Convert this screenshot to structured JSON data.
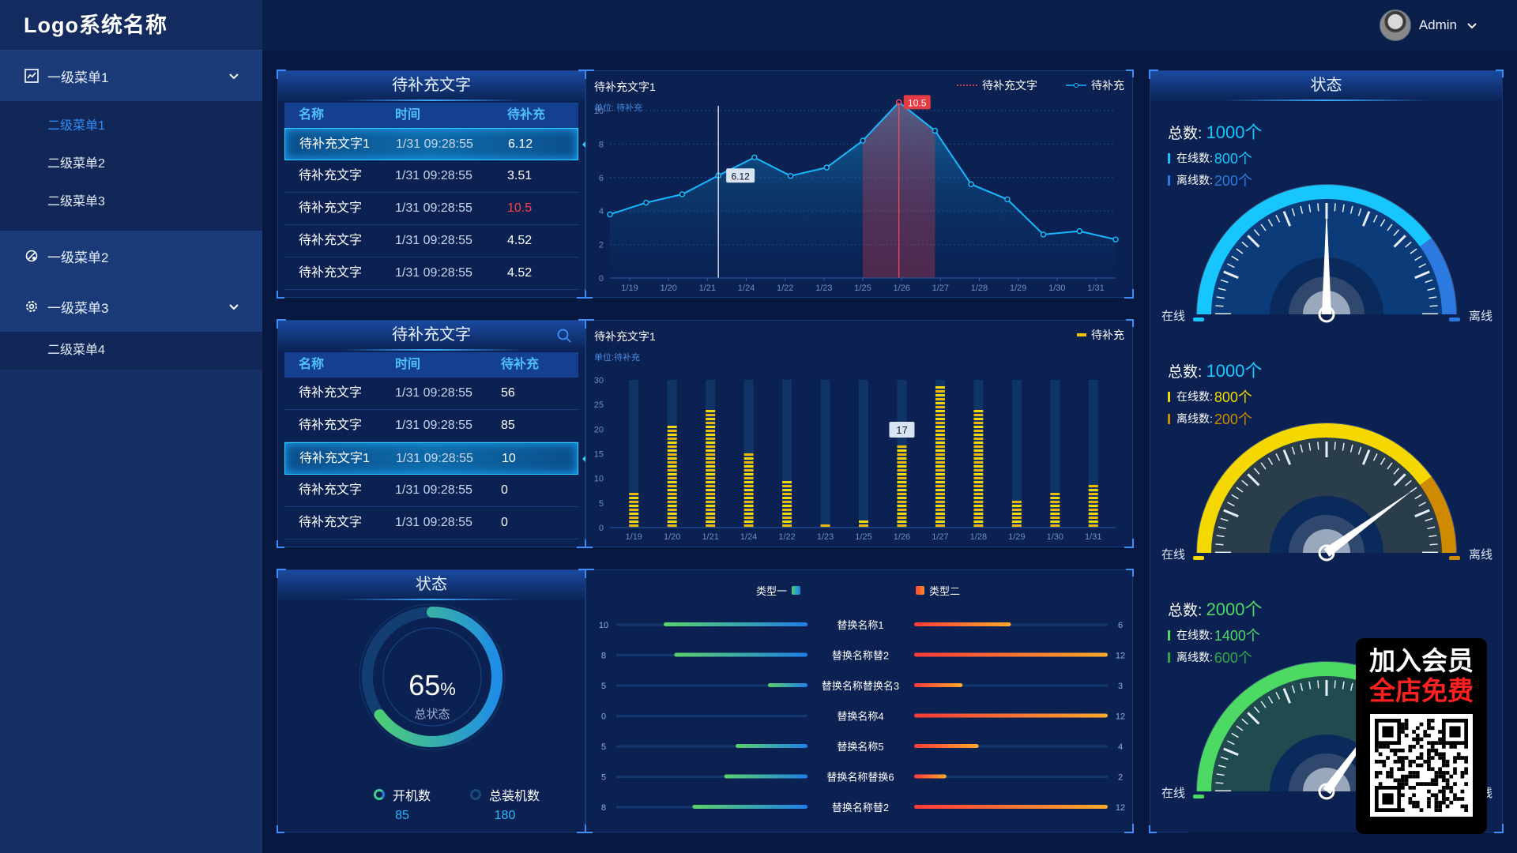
{
  "app": {
    "logo": "Logo系统名称"
  },
  "sidebar": {
    "menu1": {
      "label": "一级菜单1",
      "subs": [
        "二级菜单1",
        "二级菜单2",
        "二级菜单3"
      ]
    },
    "menu2": {
      "label": "一级菜单2"
    },
    "menu3": {
      "label": "一级菜单3",
      "subs": [
        "二级菜单4"
      ]
    }
  },
  "header": {
    "user": "Admin"
  },
  "table1": {
    "title": "待补充文字",
    "headers": [
      "名称",
      "时间",
      "待补充"
    ],
    "rows": [
      [
        "待补充文字1",
        "1/31 09:28:55",
        "6.12"
      ],
      [
        "待补充文字",
        "1/31 09:28:55",
        "3.51"
      ],
      [
        "待补充文字",
        "1/31 09:28:55",
        "10.5"
      ],
      [
        "待补充文字",
        "1/31 09:28:55",
        "4.52"
      ],
      [
        "待补充文字",
        "1/31 09:28:55",
        "4.52"
      ]
    ]
  },
  "table2": {
    "title": "待补充文字",
    "headers": [
      "名称",
      "时间",
      "待补充"
    ],
    "rows": [
      [
        "待补充文字",
        "1/31 09:28:55",
        "56"
      ],
      [
        "待补充文字",
        "1/31 09:28:55",
        "85"
      ],
      [
        "待补充文字1",
        "1/31 09:28:55",
        "10"
      ],
      [
        "待补充文字",
        "1/31 09:28:55",
        "0"
      ],
      [
        "待补充文字",
        "1/31 09:28:55",
        "0"
      ]
    ]
  },
  "colors": {
    "accent": "#2ad1ff",
    "red": "#ff3f4a",
    "yellow": "#f5d800",
    "green": "#4cd964",
    "panel": "#0a2152"
  },
  "chart_data": [
    {
      "type": "area",
      "title": "待补充文字1",
      "unit": "单位: 待补充",
      "legend": [
        "待补充文字",
        "待补充"
      ],
      "x": [
        "1/19",
        "1/20",
        "1/21",
        "1/24",
        "1/22",
        "1/23",
        "1/25",
        "1/26",
        "1/27",
        "1/28",
        "1/29",
        "1/30",
        "1/31"
      ],
      "points": [
        3.8,
        4.5,
        5.0,
        6.12,
        7.2,
        6.1,
        6.6,
        8.2,
        10.5,
        8.8,
        5.6,
        4.7,
        2.6,
        2.8,
        2.3
      ],
      "ylim": [
        0,
        10
      ],
      "yticks": [
        0,
        2,
        4,
        6,
        8,
        10
      ],
      "annotations": [
        {
          "label": "6.12"
        },
        {
          "label": "10.5"
        }
      ]
    },
    {
      "type": "bar",
      "title": "待补充文字1",
      "unit": "单位:待补充",
      "legend": [
        "待补充"
      ],
      "categories": [
        "1/19",
        "1/20",
        "1/21",
        "1/24",
        "1/22",
        "1/23",
        "1/25",
        "1/26",
        "1/27",
        "1/28",
        "1/29",
        "1/30",
        "1/31"
      ],
      "values": [
        7.5,
        21,
        24,
        15,
        9.5,
        0.8,
        1.5,
        17,
        29,
        24,
        5.5,
        7.5,
        8.5
      ],
      "ylim": [
        0,
        30
      ],
      "yticks": [
        0,
        5,
        10,
        15,
        20,
        25,
        30
      ],
      "annotation": "17"
    },
    {
      "type": "bar",
      "orientation": "horizontal-diverging",
      "legend": [
        "类型一",
        "类型二"
      ],
      "categories": [
        "替换名称1",
        "替换名称替2",
        "替换名称替换名3",
        "替换名称4",
        "替换名称5",
        "替换名称替换6",
        "替换名称替2"
      ],
      "left_values": [
        10,
        8,
        5,
        0,
        5,
        5,
        8
      ],
      "right_values": [
        6,
        12,
        3,
        12,
        4,
        2,
        12
      ]
    }
  ],
  "donut": {
    "title": "状态",
    "percent": "65",
    "unit": "%",
    "label": "总状态",
    "value": 0.65,
    "legend": [
      {
        "name": "开机数",
        "value": "85"
      },
      {
        "name": "总装机数",
        "value": "180"
      }
    ]
  },
  "status": {
    "title": "状态",
    "gauges": [
      {
        "total_label": "总数:",
        "total": "1000个",
        "online_label": "在线数:",
        "online": "800个",
        "offline_label": "离线数:",
        "offline": "200个",
        "left": "在线",
        "right": "离线",
        "ratio": 0.8,
        "color": "#17c6ff",
        "color2": "#2c7ae0"
      },
      {
        "total_label": "总数:",
        "total": "1000个",
        "online_label": "在线数:",
        "online": "800个",
        "offline_label": "离线数:",
        "offline": "200个",
        "left": "在线",
        "right": "离线",
        "ratio": 0.8,
        "color": "#f5d800",
        "color2": "#d08a00"
      },
      {
        "total_label": "总数:",
        "total": "2000个",
        "online_label": "在线数:",
        "online": "1400个",
        "offline_label": "离线数:",
        "offline": "600个",
        "left": "在线",
        "right": "离线",
        "ratio": 0.7,
        "color": "#4cd964",
        "color2": "#2fa84a"
      }
    ]
  },
  "promo": {
    "line1": "加入会员",
    "line2": "全店免费"
  }
}
